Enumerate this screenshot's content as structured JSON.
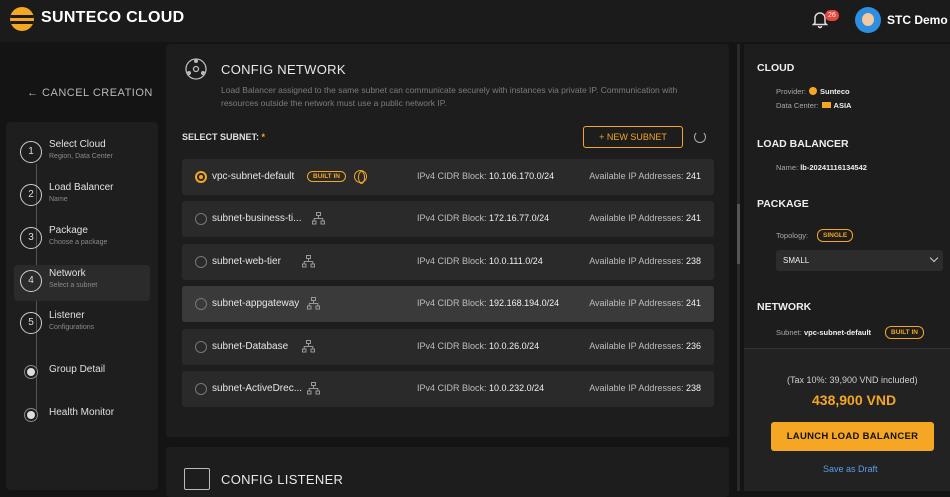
{
  "app": {
    "name": "SUNTECO CLOUD",
    "notifications": "26",
    "user": "STC Demo"
  },
  "sidebar": {
    "cancel": "← CANCEL CREATION",
    "steps": [
      {
        "num": "1",
        "title": "Select Cloud",
        "sub": "Region, Data Center"
      },
      {
        "num": "2",
        "title": "Load Balancer",
        "sub": "Name"
      },
      {
        "num": "3",
        "title": "Package",
        "sub": "Choose a package"
      },
      {
        "num": "4",
        "title": "Network",
        "sub": "Select a subnet"
      },
      {
        "num": "5",
        "title": "Listener",
        "sub": "Configurations"
      },
      {
        "title": "Group Detail"
      },
      {
        "title": "Health Monitor"
      }
    ]
  },
  "config": {
    "title": "CONFIG NETWORK",
    "desc": "Load Balancer assigned to the same subnet can communicate securely with instances via private IP. Communication with resources outside the network must use a public network IP.",
    "subnet_label": "SELECT SUBNET:",
    "required": "*",
    "new_subnet": "+ NEW SUBNET",
    "cidr_label": "IPv4 CIDR Block:",
    "avail_label": "Available IP Addresses:",
    "subnets": [
      {
        "name": "vpc-subnet-default",
        "badge": "BUILT IN",
        "cidr": "10.106.170.0/24",
        "available": "241",
        "selected": true
      },
      {
        "name": "subnet-business-ti...",
        "cidr": "172.16.77.0/24",
        "available": "241"
      },
      {
        "name": "subnet-web-tier",
        "cidr": "10.0.111.0/24",
        "available": "238"
      },
      {
        "name": "subnet-appgateway",
        "cidr": "192.168.194.0/24",
        "available": "241"
      },
      {
        "name": "subnet-Database",
        "cidr": "10.0.26.0/24",
        "available": "236"
      },
      {
        "name": "subnet-ActiveDrec...",
        "cidr": "10.0.232.0/24",
        "available": "238"
      }
    ]
  },
  "listener": {
    "title": "CONFIG LISTENER"
  },
  "summary": {
    "cloud": {
      "title": "CLOUD",
      "provider_label": "Provider:",
      "provider": "Sunteco",
      "dc_label": "Data Center:",
      "dc": "ASIA"
    },
    "lb": {
      "title": "LOAD BALANCER",
      "name_label": "Name:",
      "name": "lb-20241116134542"
    },
    "package": {
      "title": "PACKAGE",
      "topology_label": "Topology:",
      "topology": "SINGLE",
      "size": "SMALL"
    },
    "network": {
      "title": "NETWORK",
      "subnet_label": "Subnet:",
      "subnet": "vpc-subnet-default",
      "badge": "BUILT IN"
    },
    "tax": "(Tax 10%: 39,900 VND included)",
    "price": "438,900 VND",
    "launch": "LAUNCH LOAD BALANCER",
    "draft": "Save as Draft"
  },
  "colors": {
    "accent": "#f5a623",
    "link": "#5b9ee8",
    "badge": "#e8453c"
  }
}
